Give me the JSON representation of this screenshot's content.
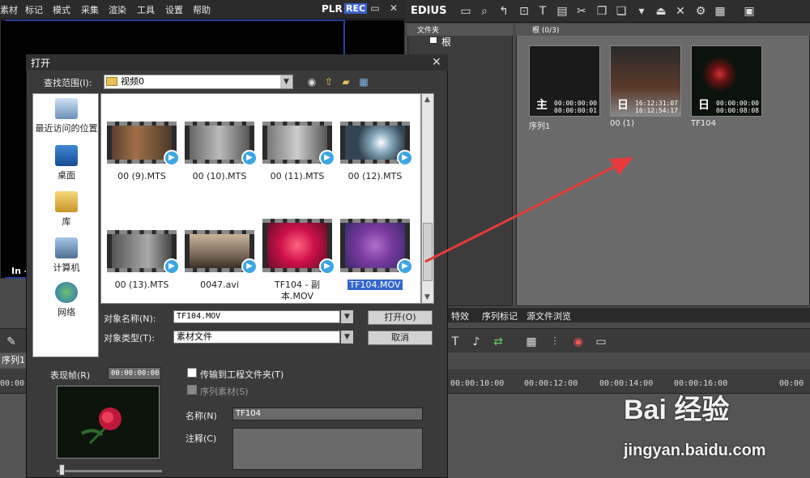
{
  "menubar": {
    "items": [
      "素材",
      "标记",
      "模式",
      "采集",
      "渲染",
      "工具",
      "设置",
      "帮助"
    ],
    "plr": "PLR",
    "rec": "REC"
  },
  "preview": {
    "in_label": "In -"
  },
  "bin": {
    "app_label": "EDIUS",
    "folders_header": "文件夹",
    "root_label": "根",
    "root_header": "根 (0/3)",
    "clips": [
      {
        "label": "序列1",
        "tc1": "00:00:00:00",
        "tc2": "00:00:00:01",
        "glyph": "主"
      },
      {
        "label": "00 (1)",
        "tc1": "16:12:31:07",
        "tc2": "16:12:54:17",
        "glyph": "日"
      },
      {
        "label": "TF104",
        "tc1": "00:00:00:00",
        "tc2": "00:00:08:08",
        "glyph": "日"
      }
    ],
    "tabs": [
      "特效",
      "序列标记",
      "源文件浏览"
    ]
  },
  "timeline": {
    "sequence_tab": "序列1",
    "ruler": [
      "00:00",
      "00:00:10:00",
      "00:00:12:00",
      "00:00:14:00",
      "00:00:16:00",
      "00:00"
    ]
  },
  "dialog": {
    "title": "打开",
    "look_in_label": "查找范围(I):",
    "look_in_value": "视频0",
    "places": [
      "最近访问的位置",
      "桌面",
      "库",
      "计算机",
      "网络"
    ],
    "files": [
      {
        "name": "00 (9).MTS"
      },
      {
        "name": "00 (10).MTS"
      },
      {
        "name": "00 (11).MTS"
      },
      {
        "name": "00 (12).MTS"
      },
      {
        "name": "00 (13).MTS"
      },
      {
        "name": "0047.avi"
      },
      {
        "name": "TF104 - 副本.MOV"
      },
      {
        "name": "TF104.MOV"
      }
    ],
    "selected_file": "TF104.MOV",
    "name_label": "对象名称(N):",
    "name_value": "TF104.MOV",
    "type_label": "对象类型(T):",
    "type_value": "素材文件",
    "open_button": "打开(O)",
    "cancel_button": "取消",
    "poster_label": "表现帧(R)",
    "poster_tc": "00:00:00:00",
    "transfer_label": "传输到工程文件夹(T)",
    "seq_label": "序列素材(S)",
    "meta_name_label": "名称(N)",
    "meta_name_value": "TF104",
    "meta_comment_label": "注释(C)"
  },
  "watermark": {
    "text": "Bai 经验",
    "url": "jingyan.baidu.com"
  },
  "colors": {
    "accent": "#3366cc",
    "arrow": "#e83a3a",
    "rec": "#3b63c8"
  }
}
